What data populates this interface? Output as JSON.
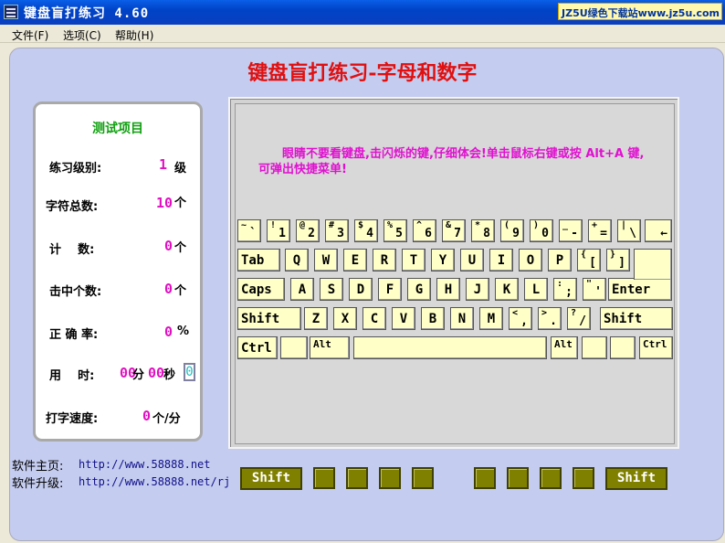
{
  "window": {
    "title": "键盘盲打练习 4.60",
    "badge": "JZ5U绿色下载站www.jz5u.com"
  },
  "menu": [
    "文件(F)",
    "选项(C)",
    "帮助(H)"
  ],
  "heading": "键盘盲打练习-字母和数字",
  "stats": {
    "title": "测试项目",
    "level_label": "练习级别:",
    "level_value": "1",
    "level_unit": "级",
    "total_label": "字符总数:",
    "total_value": "10",
    "total_unit": "个",
    "count_label": "计    数:",
    "count_value": "0",
    "count_unit": "个",
    "hit_label": "击中个数:",
    "hit_value": "0",
    "hit_unit": "个",
    "accuracy_label": "正 确 率:",
    "accuracy_value": "0",
    "accuracy_unit": "%",
    "time_label": "用    时:",
    "time_min": "00",
    "time_min_unit": "分",
    "time_sec": "00",
    "time_sec_unit": "秒",
    "time_box": "0",
    "speed_label": "打字速度:",
    "speed_value": "0",
    "speed_unit": "个/分"
  },
  "hint": "　　眼睛不要看键盘,击闪烁的键,仔细体会!单击鼠标右键或按 Alt+A 键,可弹出快捷菜单!",
  "keys": {
    "row1": [
      {
        "t": "~",
        "b": "`"
      },
      {
        "t": "!",
        "b": "1"
      },
      {
        "t": "@",
        "b": "2"
      },
      {
        "t": "#",
        "b": "3"
      },
      {
        "t": "$",
        "b": "4"
      },
      {
        "t": "%",
        "b": "5"
      },
      {
        "t": "^",
        "b": "6"
      },
      {
        "t": "&",
        "b": "7"
      },
      {
        "t": "*",
        "b": "8"
      },
      {
        "t": "(",
        "b": "9"
      },
      {
        "t": ")",
        "b": "0"
      },
      {
        "t": "_",
        "b": "-"
      },
      {
        "t": "+",
        "b": "="
      },
      {
        "t": "|",
        "b": "\\"
      },
      {
        "t": "",
        "b": "←"
      }
    ],
    "row2": [
      "Tab",
      "Q",
      "W",
      "E",
      "R",
      "T",
      "Y",
      "U",
      "I",
      "O",
      "P",
      {
        "t": "{",
        "b": "["
      },
      {
        "t": "}",
        "b": "]"
      }
    ],
    "row3": [
      "Caps",
      "A",
      "S",
      "D",
      "F",
      "G",
      "H",
      "J",
      "K",
      "L",
      {
        "t": ":",
        "b": ";"
      },
      {
        "t": "\"",
        "b": "'"
      },
      "Enter"
    ],
    "row4": [
      "Shift",
      "Z",
      "X",
      "C",
      "V",
      "B",
      "N",
      "M",
      {
        "t": "<",
        "b": ","
      },
      {
        "t": ">",
        "b": "."
      },
      {
        "t": "?",
        "b": "/"
      },
      "Shift"
    ],
    "row5": [
      "Ctrl",
      "",
      "Alt",
      "",
      "Alt",
      "",
      "",
      "Ctrl"
    ]
  },
  "footer": {
    "home_label": "软件主页:",
    "home_url": "http://www.58888.net",
    "update_label": "软件升级:",
    "update_url": "http://www.58888.net/rj",
    "shift_left": "Shift",
    "shift_right": "Shift"
  }
}
